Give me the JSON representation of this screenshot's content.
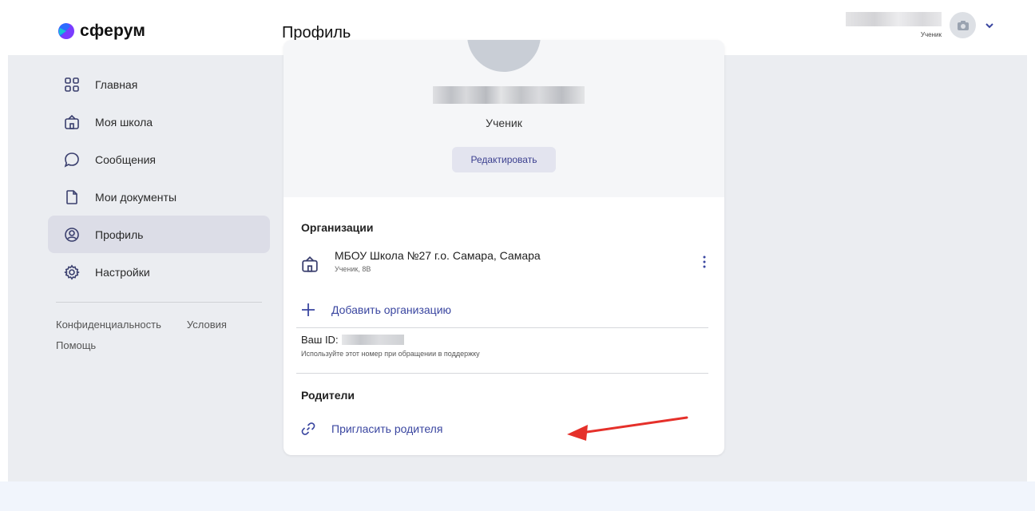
{
  "app": {
    "logo_text": "сферум",
    "brand_colors": {
      "blue": "#2d6bff",
      "purple": "#7a3cff",
      "accent": "#3a46a0",
      "annotation": "#e5302a"
    }
  },
  "header": {
    "page_title": "Профиль",
    "user_role": "Ученик",
    "avatar_icon": "camera-icon",
    "menu_icon": "chevron-down-icon"
  },
  "sidebar": {
    "items": [
      {
        "label": "Главная",
        "icon": "grid-icon"
      },
      {
        "label": "Моя школа",
        "icon": "school-icon"
      },
      {
        "label": "Сообщения",
        "icon": "chat-bubble-icon"
      },
      {
        "label": "Мои документы",
        "icon": "document-icon"
      },
      {
        "label": "Профиль",
        "icon": "profile-icon",
        "active": true
      },
      {
        "label": "Настройки",
        "icon": "gear-icon"
      }
    ],
    "footer": {
      "privacy": "Конфиденциальность",
      "terms": "Условия",
      "help": "Помощь"
    }
  },
  "profile": {
    "role": "Ученик",
    "edit_label": "Редактировать",
    "organizations_title": "Организации",
    "org_name": "МБОУ Школа №27 г.о. Самара, Самара",
    "org_sub": "Ученик, 8В",
    "add_org_label": "Добавить организацию",
    "id_label": "Ваш ID:",
    "id_hint": "Используйте этот номер при обращении в поддержку",
    "parents_title": "Родители",
    "invite_parent_label": "Пригласить родителя"
  }
}
